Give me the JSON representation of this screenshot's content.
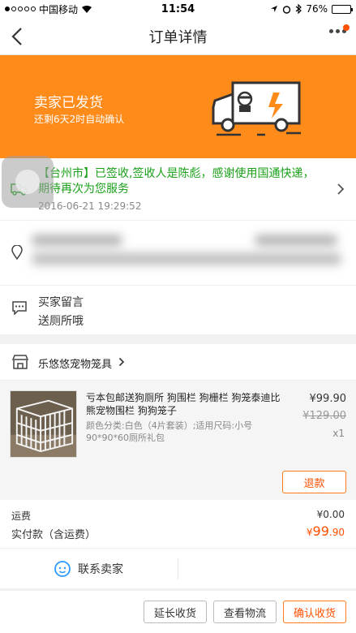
{
  "status_bar": {
    "carrier": "中国移动",
    "time": "11:54",
    "battery": "76%",
    "battery_level": 0.76
  },
  "nav": {
    "title": "订单详情"
  },
  "banner": {
    "status": "卖家已发货",
    "auto_confirm": "还剩6天2时自动确认"
  },
  "logistics": {
    "message": "【台州市】已签收,签收人是陈彪，感谢使用国通快递，期待再次为您服务",
    "time": "2016-06-21 19:29:52"
  },
  "buyer_note": {
    "label": "买家留言",
    "value": "送厕所哦"
  },
  "shop": {
    "name": "乐悠悠宠物笼具"
  },
  "product": {
    "title": "亏本包邮送狗厕所 狗围栏 狗栅栏 狗笼泰迪比熊宠物围栏 狗狗笼子",
    "sku": "颜色分类:白色（4片套装）;适用尺码:小号90*90*60厕所礼包",
    "price": "¥99.90",
    "original_price": "¥129.00",
    "quantity": "x1",
    "refund_label": "退款"
  },
  "totals": {
    "shipping_label": "运费",
    "shipping_value": "¥0.00",
    "paid_label": "实付款（含运费）",
    "paid_currency": "¥",
    "paid_int": "99",
    "paid_dec": ".90"
  },
  "contact": {
    "label": "联系卖家"
  },
  "actions": {
    "extend": "延长收货",
    "view_logistics": "查看物流",
    "confirm": "确认收货"
  },
  "colors": {
    "accent": "#ff8b1b",
    "price_red": "#ff5000",
    "logistics_green": "#1aa01a"
  }
}
